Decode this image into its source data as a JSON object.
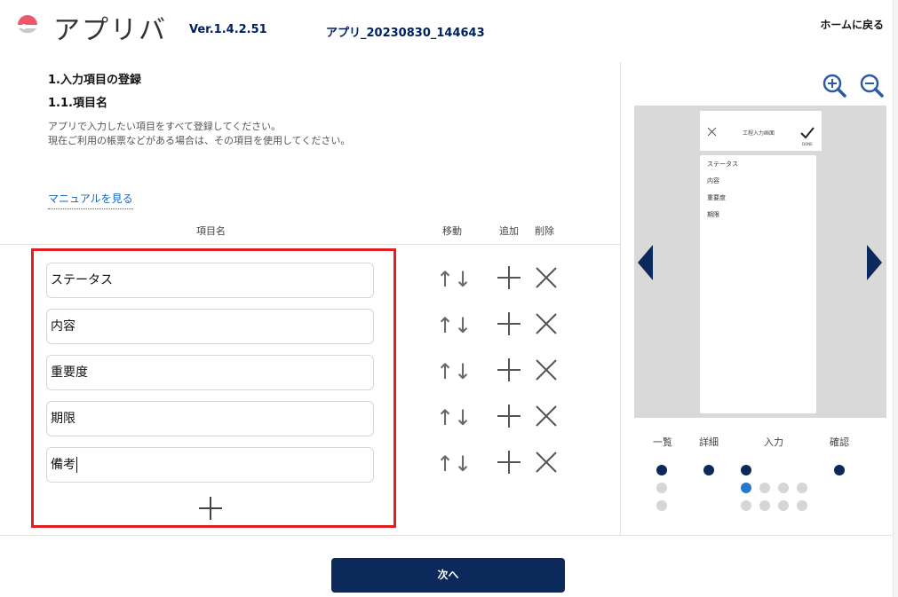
{
  "header": {
    "app_name": "アプリバ",
    "version": "Ver.1.4.2.51",
    "app_file": "アプリ_20230830_144643",
    "home_label": "ホームに戻る"
  },
  "section": {
    "title": "1.入力項目の登録",
    "subtitle": "1.1.項目名",
    "description_line1": "アプリで入力したい項目をすべて登録してください。",
    "description_line2": "現在ご利用の帳票などがある場合は、その項目を使用してください。",
    "manual_link": "マニュアルを見る"
  },
  "table": {
    "columns": {
      "name": "項目名",
      "move": "移動",
      "add": "追加",
      "delete": "削除"
    },
    "rows": [
      {
        "value": "ステータス"
      },
      {
        "value": "内容"
      },
      {
        "value": "重要度"
      },
      {
        "value": "期限"
      },
      {
        "value": "備考"
      }
    ],
    "move_up_glyph": "↑",
    "move_down_glyph": "↓"
  },
  "preview": {
    "phone_title": "工程入力画面",
    "phone_done_label": "DONE",
    "items": [
      "ステータス",
      "内容",
      "重要度",
      "期限"
    ],
    "icons": [
      "zoom-in-icon",
      "zoom-out-icon",
      "close-icon",
      "check-icon",
      "prev-arrow-icon",
      "next-arrow-icon"
    ]
  },
  "steps": {
    "labels": [
      "一覧",
      "詳細",
      "入力",
      "確認"
    ],
    "current_step": "入力"
  },
  "footer": {
    "next_label": "次へ"
  },
  "colors": {
    "navy": "#0b2a5b",
    "accent_blue": "#2678c8",
    "link_blue": "#1565c0",
    "highlight_red": "#e02020",
    "logo_pink": "#f0566a"
  }
}
